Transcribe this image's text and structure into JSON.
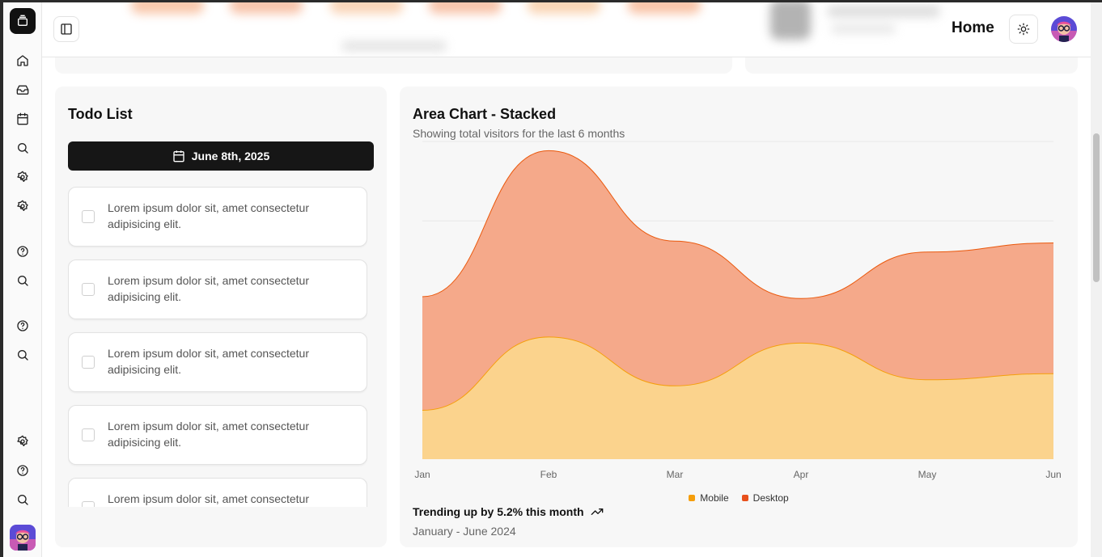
{
  "header": {
    "title": "Home"
  },
  "todo": {
    "title": "Todo List",
    "date": "June 8th, 2025",
    "items": [
      {
        "text": "Lorem ipsum dolor sit, amet consectetur adipisicing elit.",
        "checked": false
      },
      {
        "text": "Lorem ipsum dolor sit, amet consectetur adipisicing elit.",
        "checked": false
      },
      {
        "text": "Lorem ipsum dolor sit, amet consectetur adipisicing elit.",
        "checked": false
      },
      {
        "text": "Lorem ipsum dolor sit, amet consectetur adipisicing elit.",
        "checked": false
      },
      {
        "text": "Lorem ipsum dolor sit, amet consectetur adipisicing elit.",
        "checked": false
      }
    ]
  },
  "chart": {
    "title": "Area Chart - Stacked",
    "subtitle": "Showing total visitors for the last 6 months",
    "trend": "Trending up by 5.2% this month",
    "range": "January - June 2024"
  },
  "chart_data": {
    "type": "area",
    "stacked": true,
    "categories": [
      "Jan",
      "Feb",
      "Mar",
      "Apr",
      "May",
      "Jun"
    ],
    "series": [
      {
        "name": "Mobile",
        "values": [
          80,
          200,
          120,
          190,
          130,
          140
        ],
        "color": "#fbd38d"
      },
      {
        "name": "Desktop",
        "values": [
          186,
          305,
          237,
          73,
          209,
          214
        ],
        "color": "#f5a98a"
      }
    ],
    "line_colors": {
      "Mobile": "#f59e0b",
      "Desktop": "#ea580c"
    },
    "legend_colors": {
      "Mobile": "#f59e0b",
      "Desktop": "#e8501c"
    },
    "ylim": [
      0,
      520
    ],
    "grid": "horizontal",
    "legend": "bottom-center"
  },
  "colors": {
    "accent_dark": "#161616",
    "card_bg": "#f7f7f7"
  },
  "icons": {
    "sidebar": [
      "home-icon",
      "inbox-icon",
      "calendar-icon",
      "search-icon",
      "settings-icon",
      "settings-icon",
      "help-icon",
      "search-icon",
      "help-icon",
      "search-icon",
      "settings-icon",
      "help-icon",
      "search-icon"
    ]
  }
}
